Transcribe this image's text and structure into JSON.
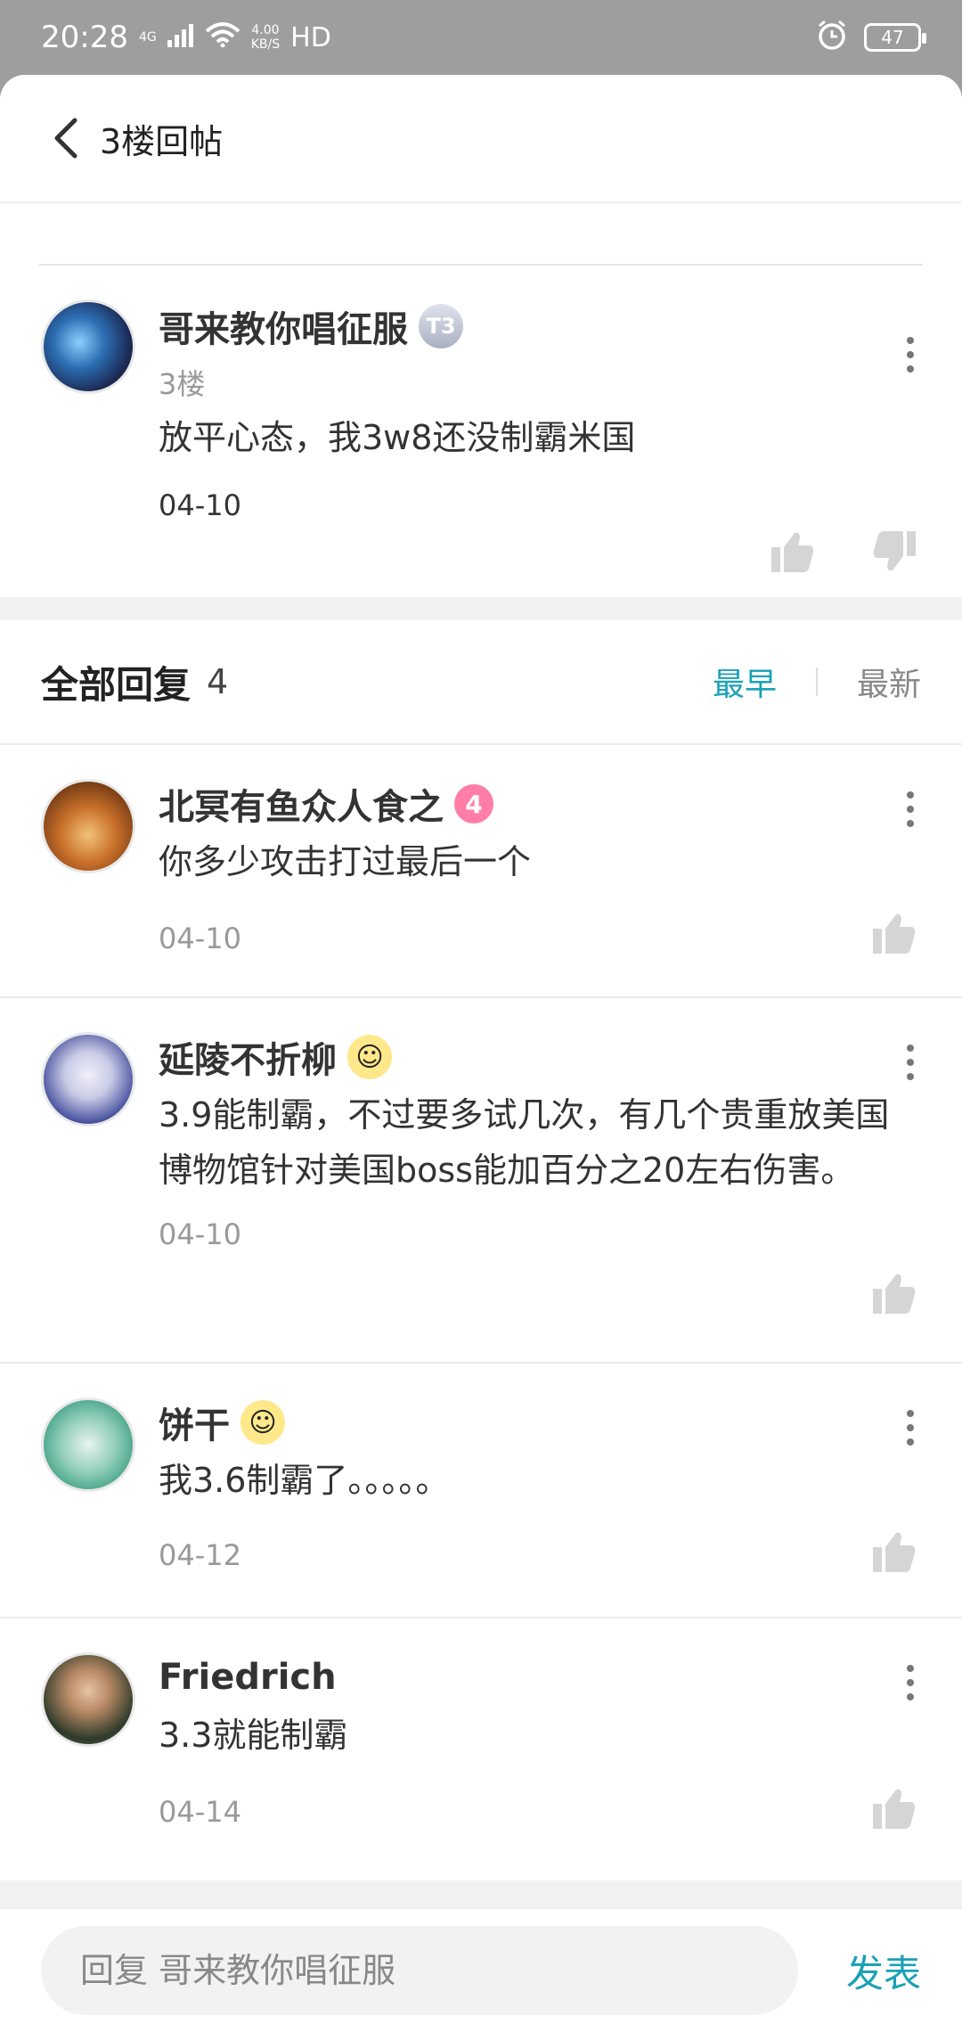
{
  "status_bar": {
    "time": "20:28",
    "network": "4G",
    "speed": "4.00\nKB/S",
    "hd": "HD",
    "battery": "47"
  },
  "header": {
    "title": "3楼回帖"
  },
  "main_post": {
    "username": "哥来教你唱征服",
    "badge": "T3",
    "floor": "3楼",
    "content": "放平心态，我3w8还没制霸米国",
    "date": "04-10"
  },
  "replies_section": {
    "title": "全部回复",
    "count": "4",
    "sort_earliest": "最早",
    "sort_latest": "最新"
  },
  "replies": [
    {
      "username": "北冥有鱼众人食之",
      "badge": "4",
      "content": "你多少攻击打过最后一个",
      "date": "04-10"
    },
    {
      "username": "延陵不折柳",
      "content": "3.9能制霸，不过要多试几次，有几个贵重放美国博物馆针对美国boss能加百分之20左右伤害。",
      "date": "04-10"
    },
    {
      "username": "饼干",
      "content": "我3.6制霸了。。。。。",
      "date": "04-12"
    },
    {
      "username": "Friedrich",
      "content": "3.3就能制霸",
      "date": "04-14"
    }
  ],
  "reply_bar": {
    "placeholder": "回复 哥来教你唱征服",
    "send_label": "发表"
  }
}
